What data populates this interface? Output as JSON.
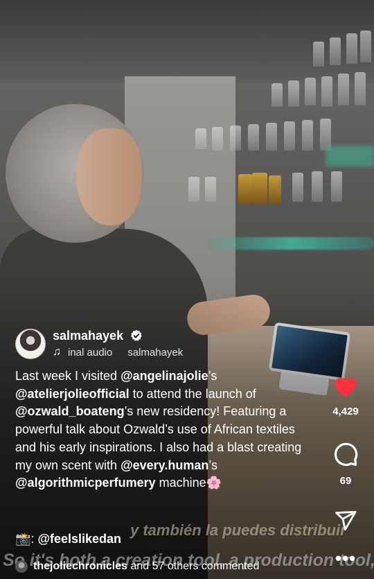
{
  "author": {
    "username": "salmahayek",
    "verified": true,
    "audio_track": "inal audio",
    "audio_artist": "salmahayek"
  },
  "caption": {
    "p1": "Last week I visited ",
    "m1": "@angelinajolie",
    "p2": "’s ",
    "m2": "@atelierjolieofficial",
    "p3": " to attend the launch of ",
    "m3": "@ozwald_boateng",
    "p4": "’s new residency! Featuring a powerful talk about Ozwald’s use of African textiles and his early inspirations. I also had a blast creating my own scent with ",
    "m4": "@every.human",
    "p5": "’s ",
    "m5": "@algorithmicperfumery",
    "p6": " machine",
    "emoji": "🌸"
  },
  "photo_credit": {
    "emoji": "📸",
    "prefix": ": ",
    "handle": "@feelslikedan"
  },
  "comments": {
    "user": "thejoliechronicles",
    "rest": " and 57 others commented"
  },
  "actions": {
    "likes": "4,429",
    "comments": "69"
  },
  "subtitles": {
    "spanish": "y también la puedes distribuir",
    "english": "So it's both a creation tool, a production tool,"
  },
  "colors": {
    "like_red": "#ff3040",
    "text": "#ffffff"
  },
  "icons": [
    "verified-badge-icon",
    "music-note-icon",
    "heart-icon",
    "comment-icon",
    "share-icon",
    "more-icon"
  ]
}
